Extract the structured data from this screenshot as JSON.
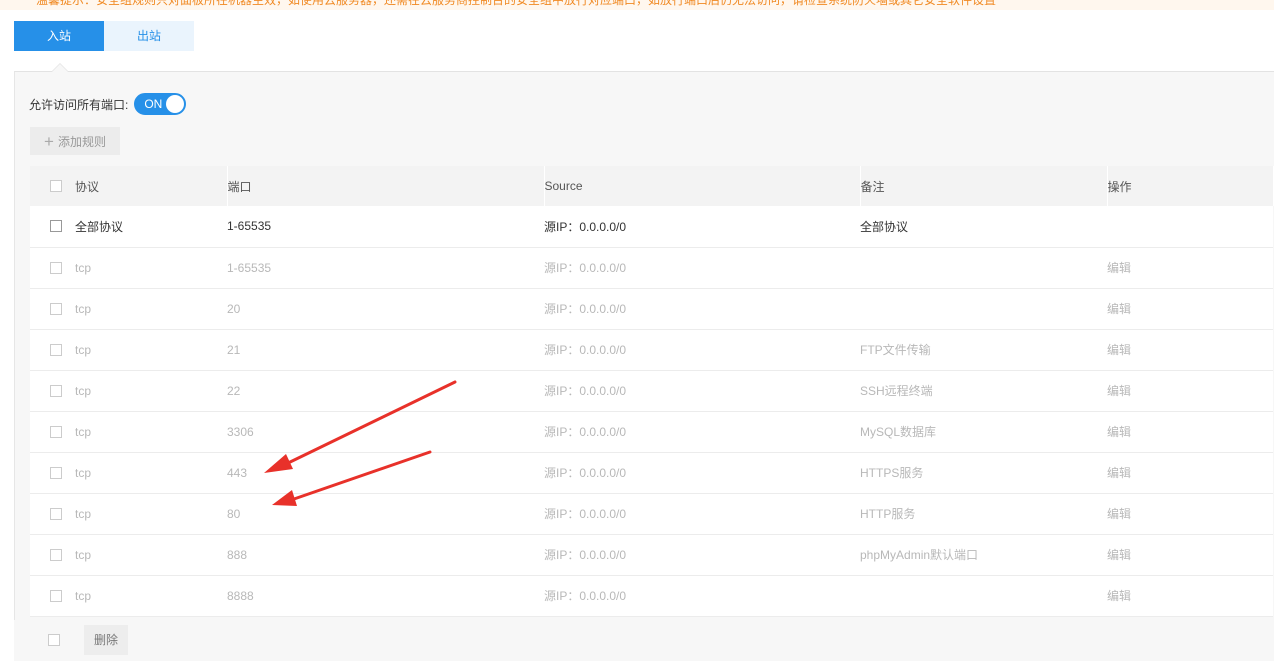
{
  "notice": {
    "text": "温馨提示：安全组规则只对面板所在机器生效，如使用云服务器，还需在云服务商控制台的安全组中放行对应端口，如放行端口后仍无法访问，请检查系统防火墙或其它安全软件设置"
  },
  "tabs": [
    {
      "label": "入站",
      "active": true
    },
    {
      "label": "出站",
      "active": false
    }
  ],
  "allow_all_ports": {
    "label": "允许访问所有端口:",
    "toggle_text": "ON",
    "enabled": true
  },
  "add_rule_button": {
    "label": "添加规则",
    "icon": "plus-icon"
  },
  "table": {
    "headers": {
      "protocol": "协议",
      "port": "端口",
      "source": "Source",
      "remark": "备注",
      "action": "操作"
    },
    "rows": [
      {
        "protocol": "全部协议",
        "port": "1-65535",
        "source": "源IP：0.0.0.0/0",
        "remark": "全部协议",
        "action": "",
        "state": "strong"
      },
      {
        "protocol": "tcp",
        "port": "1-65535",
        "source": "源IP：0.0.0.0/0",
        "remark": "",
        "action": "编辑",
        "state": "dim"
      },
      {
        "protocol": "tcp",
        "port": "20",
        "source": "源IP：0.0.0.0/0",
        "remark": "",
        "action": "编辑",
        "state": "dim"
      },
      {
        "protocol": "tcp",
        "port": "21",
        "source": "源IP：0.0.0.0/0",
        "remark": "FTP文件传输",
        "action": "编辑",
        "state": "dim"
      },
      {
        "protocol": "tcp",
        "port": "22",
        "source": "源IP：0.0.0.0/0",
        "remark": "SSH远程终端",
        "action": "编辑",
        "state": "dim"
      },
      {
        "protocol": "tcp",
        "port": "3306",
        "source": "源IP：0.0.0.0/0",
        "remark": "MySQL数据库",
        "action": "编辑",
        "state": "dim"
      },
      {
        "protocol": "tcp",
        "port": "443",
        "source": "源IP：0.0.0.0/0",
        "remark": "HTTPS服务",
        "action": "编辑",
        "state": "dim"
      },
      {
        "protocol": "tcp",
        "port": "80",
        "source": "源IP：0.0.0.0/0",
        "remark": "HTTP服务",
        "action": "编辑",
        "state": "dim"
      },
      {
        "protocol": "tcp",
        "port": "888",
        "source": "源IP：0.0.0.0/0",
        "remark": "phpMyAdmin默认端口",
        "action": "编辑",
        "state": "dim"
      },
      {
        "protocol": "tcp",
        "port": "8888",
        "source": "源IP：0.0.0.0/0",
        "remark": "",
        "action": "编辑",
        "state": "dim"
      }
    ]
  },
  "footer": {
    "delete_label": "删除"
  },
  "colors": {
    "accent": "#2690e8",
    "annotation": "#e8312a",
    "notice": "#f08a24"
  }
}
